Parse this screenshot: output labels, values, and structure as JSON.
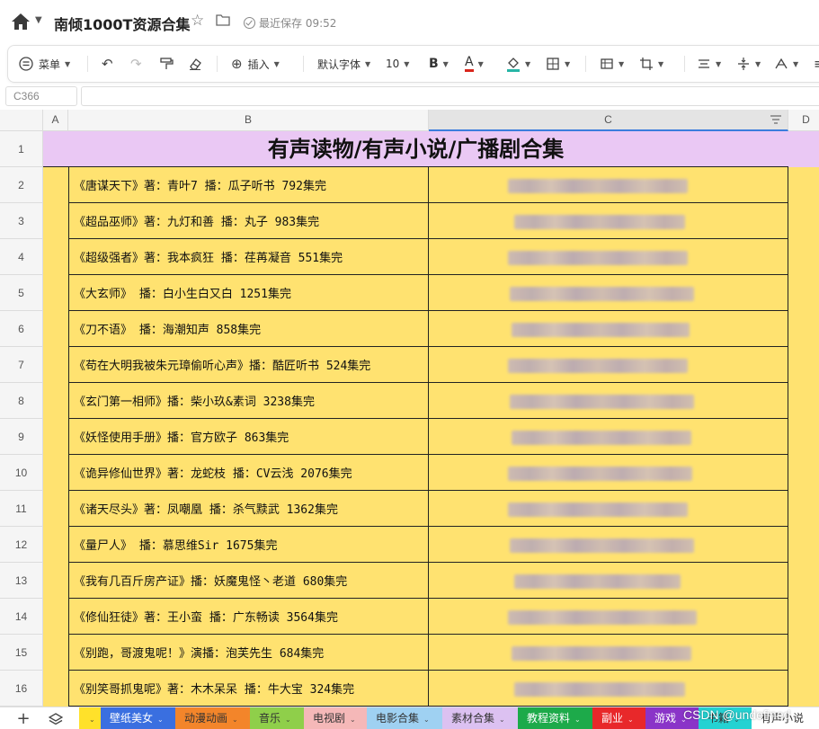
{
  "header": {
    "title": "南倾1000T资源合集",
    "save_status": "最近保存 09:52"
  },
  "toolbar": {
    "menu_label": "菜单",
    "insert_label": "插入",
    "font_name": "默认字体",
    "font_size": "10",
    "bold_label": "B",
    "font_color_label": "A",
    "font_color": "#d9261c",
    "fill_color": "#27b5a6"
  },
  "formula_bar": {
    "cell_ref": "C366",
    "content": ""
  },
  "columns": [
    "A",
    "B",
    "C",
    "D"
  ],
  "sheet": {
    "title": "有声读物/有声小说/广播剧合集",
    "title_row": "1",
    "rows": [
      {
        "num": "2",
        "text": "《唐谋天下》著：青叶7 播：瓜子听书 792集完"
      },
      {
        "num": "3",
        "text": "《超品巫师》著：九灯和善 播：丸子 983集完"
      },
      {
        "num": "4",
        "text": "《超级强者》著：我本疯狂 播：荏苒凝音 551集完"
      },
      {
        "num": "5",
        "text": "《大玄师》 播：白小生白又白 1251集完"
      },
      {
        "num": "6",
        "text": "《刀不语》 播：海潮知声 858集完"
      },
      {
        "num": "7",
        "text": "《苟在大明我被朱元璋偷听心声》播：酷匠听书 524集完"
      },
      {
        "num": "8",
        "text": "《玄门第一相师》播：柴小玖&素词 3238集完"
      },
      {
        "num": "9",
        "text": "《妖怪使用手册》播：官方欧子 863集完"
      },
      {
        "num": "10",
        "text": "《诡异修仙世界》著：龙蛇枝 播：CV云浅 2076集完"
      },
      {
        "num": "11",
        "text": "《诸天尽头》著：凤嘲凰 播：杀气黩武 1362集完"
      },
      {
        "num": "12",
        "text": "《量尸人》 播：慕思维Sir 1675集完"
      },
      {
        "num": "13",
        "text": "《我有几百斤房产证》播：妖魔鬼怪丶老道 680集完"
      },
      {
        "num": "14",
        "text": "《修仙狂徒》著：王小蛮 播：广东畅读 3564集完"
      },
      {
        "num": "15",
        "text": "《别跑，哥渡鬼呢！》演播：泡芙先生 684集完"
      },
      {
        "num": "16",
        "text": "《别笑哥抓鬼呢》著：木木呆呆 播：牛大宝 324集完"
      }
    ]
  },
  "tabs": [
    {
      "label": "",
      "color": "#ffe12a",
      "text_color": "#333333"
    },
    {
      "label": "壁纸美女",
      "color": "#3a6fe0",
      "text_color": "#ffffff"
    },
    {
      "label": "动漫动画",
      "color": "#f3852a",
      "text_color": "#333333"
    },
    {
      "label": "音乐",
      "color": "#8fcf4a",
      "text_color": "#333333"
    },
    {
      "label": "电视剧",
      "color": "#f5b8b8",
      "text_color": "#333333"
    },
    {
      "label": "电影合集",
      "color": "#9fd1f2",
      "text_color": "#333333"
    },
    {
      "label": "素材合集",
      "color": "#dcc1f1",
      "text_color": "#333333"
    },
    {
      "label": "教程资料",
      "color": "#1daa4a",
      "text_color": "#ffffff"
    },
    {
      "label": "副业",
      "color": "#e8282a",
      "text_color": "#ffffff"
    },
    {
      "label": "游戏",
      "color": "#8a34c8",
      "text_color": "#ffffff"
    },
    {
      "label": "书籍",
      "color": "#24d2d2",
      "text_color": "#333333"
    },
    {
      "label": "有声小说",
      "color": "#ffffff",
      "text_color": "#333333"
    }
  ],
  "watermark": "CSDN @undefined"
}
